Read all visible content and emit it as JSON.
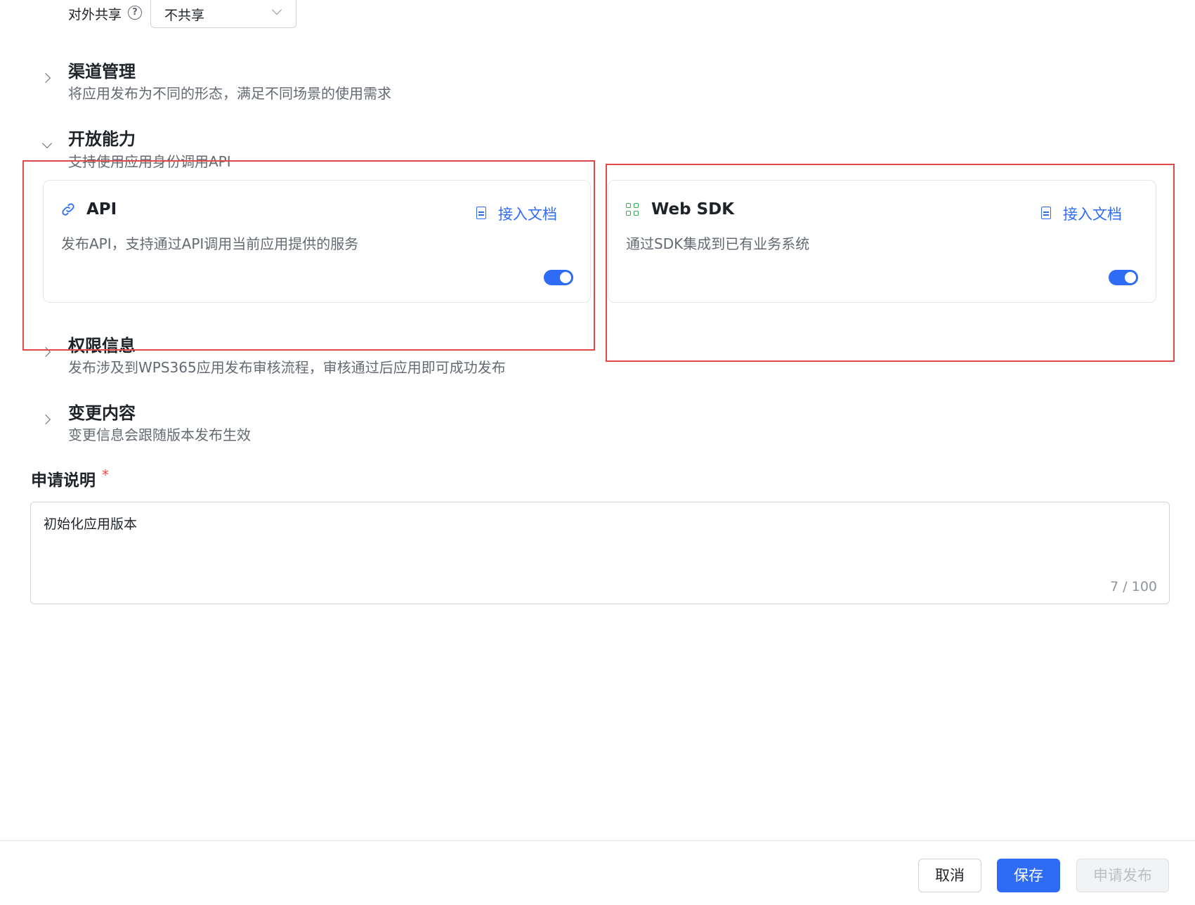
{
  "share": {
    "label": "对外共享",
    "help_icon": "help-circle-icon",
    "value": "不共享"
  },
  "sections": {
    "channel": {
      "title": "渠道管理",
      "desc": "将应用发布为不同的形态，满足不同场景的使用需求"
    },
    "open": {
      "title": "开放能力",
      "desc": "支持使用应用身份调用API"
    },
    "permission": {
      "title": "权限信息",
      "desc": "发布涉及到WPS365应用发布审核流程，审核通过后应用即可成功发布"
    },
    "changes": {
      "title": "变更内容",
      "desc": "变更信息会跟随版本发布生效"
    }
  },
  "cards": {
    "api": {
      "title": "API",
      "icon": "link-icon",
      "doc_label": "接入文档",
      "desc": "发布API，支持通过API调用当前应用提供的服务",
      "enabled": true
    },
    "websdk": {
      "title": "Web SDK",
      "icon": "grid-icon",
      "doc_label": "接入文档",
      "desc": "通过SDK集成到已有业务系统",
      "enabled": true
    }
  },
  "request": {
    "title": "申请说明",
    "required_mark": "*",
    "value": "初始化应用版本",
    "count": "7 / 100"
  },
  "footer": {
    "cancel": "取消",
    "save": "保存",
    "publish": "申请发布"
  },
  "colors": {
    "primary": "#2e6cf6",
    "highlight_box": "#e0494a",
    "icon_green": "#34a853"
  }
}
